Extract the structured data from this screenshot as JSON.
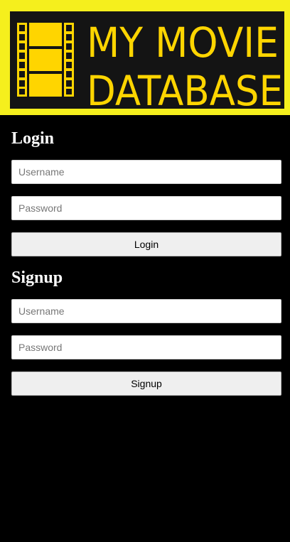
{
  "banner": {
    "logo_line1": "MY MOVIE",
    "logo_line2": "DATABASE",
    "icon": "film-strip-icon",
    "colors": {
      "accent": "#f5ef1d",
      "logo_background": "#141414",
      "film_yellow": "#ffd500"
    }
  },
  "login": {
    "title": "Login",
    "username_placeholder": "Username",
    "password_placeholder": "Password",
    "button_label": "Login"
  },
  "signup": {
    "title": "Signup",
    "username_placeholder": "Username",
    "password_placeholder": "Password",
    "button_label": "Signup"
  }
}
